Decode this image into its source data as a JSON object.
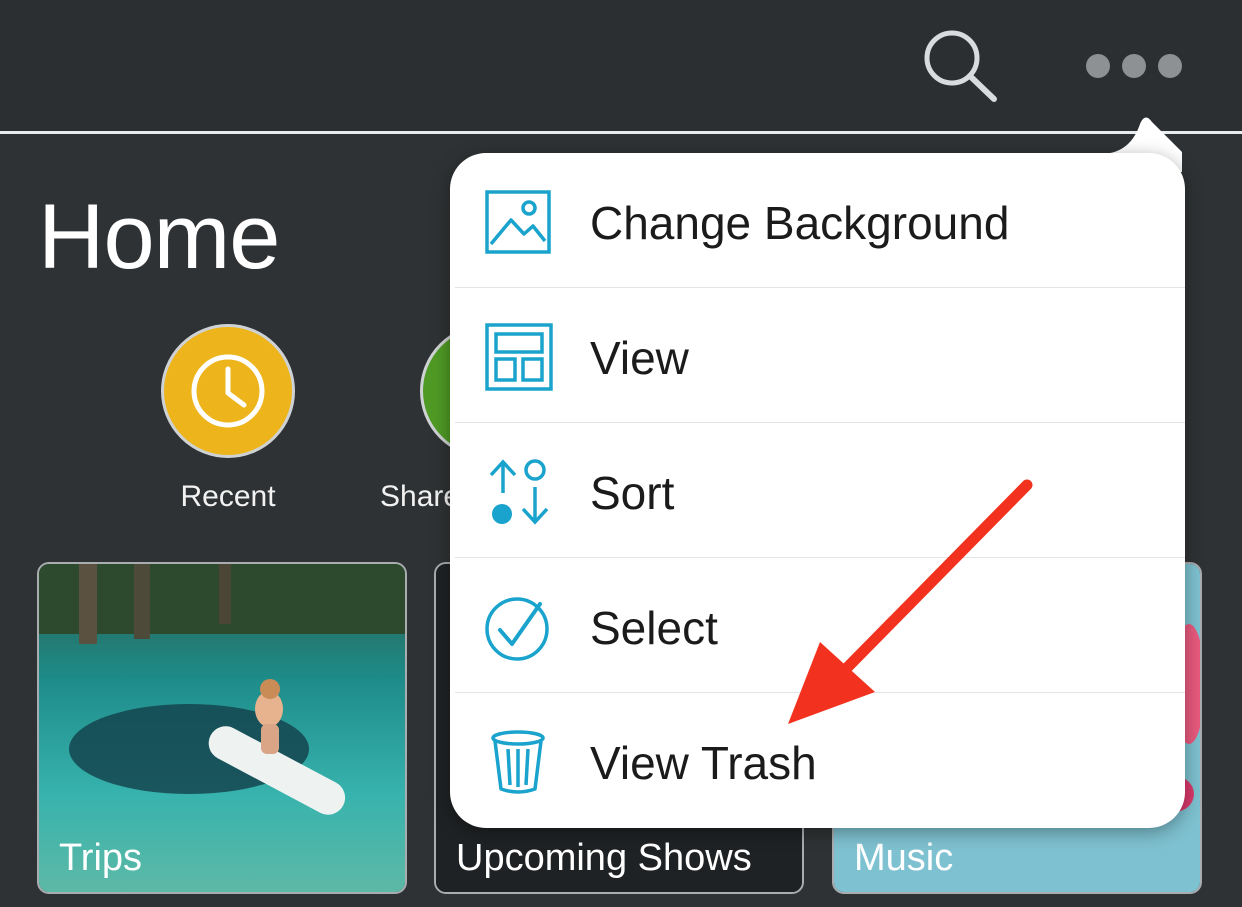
{
  "page": {
    "title": "Home"
  },
  "colors": {
    "accent": "#1aa3cc",
    "annotation_arrow": "#f2321e",
    "recent": "#edb51b",
    "shared": "#4f9a24"
  },
  "topbar": {
    "search_icon": "search-icon",
    "more_icon": "more-options-icon"
  },
  "quick_actions": [
    {
      "label": "Recent",
      "icon": "clock-icon"
    },
    {
      "label": "Share",
      "icon": "share-icon"
    }
  ],
  "albums": [
    {
      "label": "Trips"
    },
    {
      "label": "Upcoming Shows"
    },
    {
      "label": "Music"
    }
  ],
  "menu": {
    "items": [
      {
        "label": "Change Background",
        "icon": "image-icon"
      },
      {
        "label": "View",
        "icon": "layout-icon"
      },
      {
        "label": "Sort",
        "icon": "sort-icon"
      },
      {
        "label": "Select",
        "icon": "checkmark-circle-icon"
      },
      {
        "label": "View Trash",
        "icon": "trash-icon"
      }
    ]
  }
}
